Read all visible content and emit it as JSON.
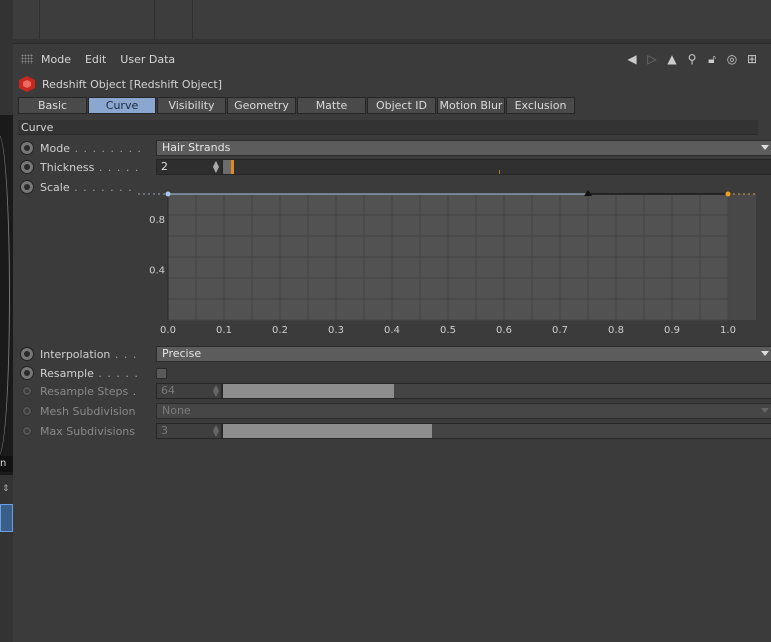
{
  "menu": {
    "items": [
      "Mode",
      "Edit",
      "User Data"
    ]
  },
  "object": {
    "title": "Redshift Object [Redshift Object]"
  },
  "tabs": [
    {
      "label": "Basic",
      "active": false
    },
    {
      "label": "Curve",
      "active": true
    },
    {
      "label": "Visibility",
      "active": false
    },
    {
      "label": "Geometry",
      "active": false
    },
    {
      "label": "Matte",
      "active": false
    },
    {
      "label": "Object ID",
      "active": false
    },
    {
      "label": "Motion Blur",
      "active": false
    },
    {
      "label": "Exclusion",
      "active": false
    }
  ],
  "section": {
    "title": "Curve"
  },
  "params": {
    "mode": {
      "label": "Mode",
      "dots": " . . . . . . . . . .",
      "value": "Hair Strands"
    },
    "thickness": {
      "label": "Thickness",
      "dots": " . . . . . .",
      "value": "2",
      "fraction": 0.02
    },
    "scale": {
      "label": "Scale",
      "dots": " . . . . . . . . ."
    },
    "interpolation": {
      "label": "Interpolation",
      "dots": " . . . .",
      "value": "Precise"
    },
    "resample": {
      "label": "Resample",
      "dots": " . . . . . . .",
      "checked": false
    },
    "resample_steps": {
      "label": "Resample Steps",
      "dots": " . .",
      "value": "64",
      "fraction": 0.31
    },
    "mesh_subdivision": {
      "label": "Mesh Subdivision",
      "value": "None"
    },
    "max_subdivisions": {
      "label": "Max Subdivisions",
      "value": "3",
      "fraction": 0.38
    }
  },
  "chart_data": {
    "type": "line",
    "x_ticks": [
      "0.0",
      "0.1",
      "0.2",
      "0.3",
      "0.4",
      "0.5",
      "0.6",
      "0.7",
      "0.8",
      "0.9",
      "1.0"
    ],
    "y_ticks": [
      "0.8",
      "0.4"
    ],
    "xlim": [
      0,
      1.0
    ],
    "ylim": [
      0,
      1.0
    ],
    "grid": true,
    "points": [
      {
        "x": 0.0,
        "y": 1.0
      },
      {
        "x": 0.75,
        "y": 1.0
      },
      {
        "x": 1.0,
        "y": 1.0
      }
    ]
  },
  "viewport": {
    "corner_text": "n"
  }
}
